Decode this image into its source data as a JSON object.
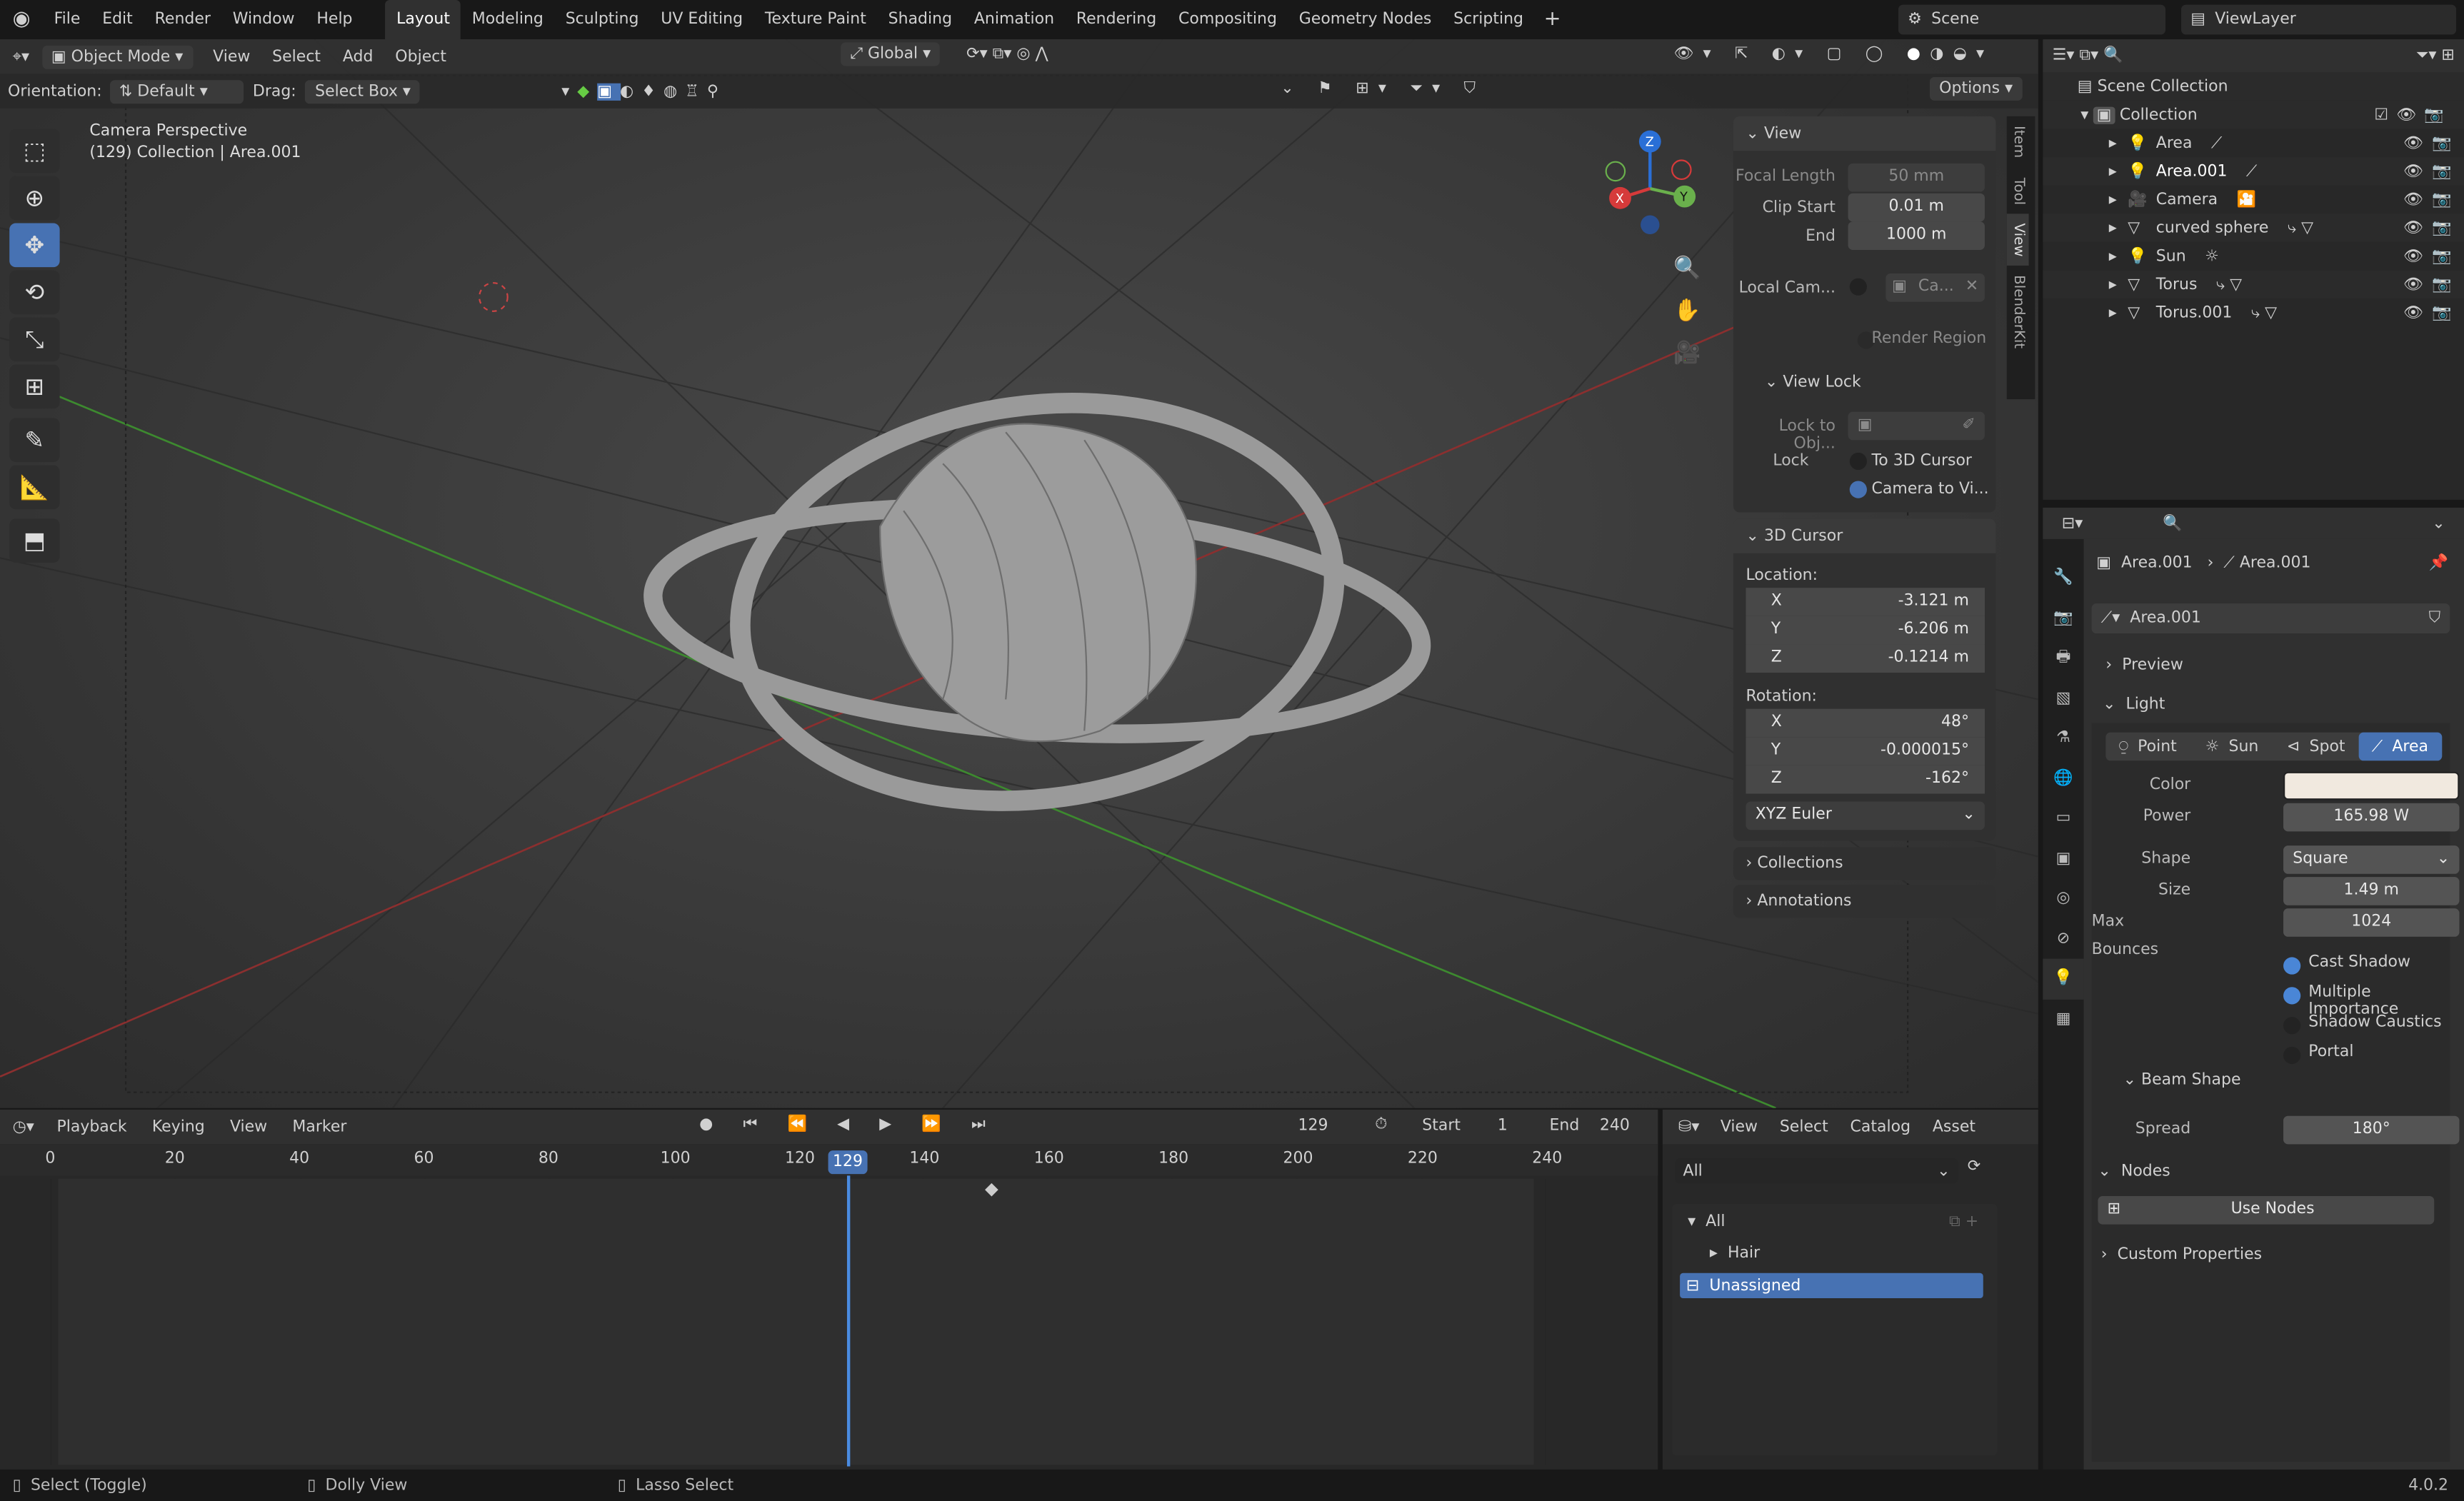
{
  "topbar": {
    "menus": [
      "File",
      "Edit",
      "Render",
      "Window",
      "Help"
    ],
    "workspaces": [
      "Layout",
      "Modeling",
      "Sculpting",
      "UV Editing",
      "Texture Paint",
      "Shading",
      "Animation",
      "Rendering",
      "Compositing",
      "Geometry Nodes",
      "Scripting"
    ],
    "active_workspace": "Layout",
    "scene": "Scene",
    "view_layer": "ViewLayer"
  },
  "viewport": {
    "mode": "Object Mode",
    "menus": [
      "View",
      "Select",
      "Add",
      "Object"
    ],
    "transform_orientation": "Global",
    "orientation_label": "Orientation:",
    "orientation_value": "Default",
    "drag_label": "Drag:",
    "drag_value": "Select Box",
    "options": "Options",
    "overlay_title": "Camera Perspective",
    "overlay_sub": "(129) Collection | Area.001",
    "gizmo": {
      "x": "X",
      "y": "Y",
      "z": "Z"
    },
    "accent": "#4772b3"
  },
  "npanel": {
    "tabs": [
      "Item",
      "Tool",
      "View",
      "BlenderKit"
    ],
    "active_tab": "View",
    "view": {
      "title": "View",
      "focal_label": "Focal Length",
      "focal": "50 mm",
      "clip_start_label": "Clip Start",
      "clip_start": "0.01 m",
      "end_label": "End",
      "end": "1000 m",
      "local_cam_label": "Local Cam...",
      "local_cam_value": "Ca...",
      "render_region": "Render Region"
    },
    "view_lock": {
      "title": "View Lock",
      "lock_obj_label": "Lock to Obj...",
      "lock_label": "Lock",
      "to_cursor": "To 3D Cursor",
      "camera_to_view": "Camera to Vi..."
    },
    "cursor": {
      "title": "3D Cursor",
      "location_label": "Location:",
      "loc": [
        {
          "axis": "X",
          "value": "-3.121 m"
        },
        {
          "axis": "Y",
          "value": "-6.206 m"
        },
        {
          "axis": "Z",
          "value": "-0.1214 m"
        }
      ],
      "rotation_label": "Rotation:",
      "rot": [
        {
          "axis": "X",
          "value": "48°"
        },
        {
          "axis": "Y",
          "value": "-0.000015°"
        },
        {
          "axis": "Z",
          "value": "-162°"
        }
      ],
      "mode": "XYZ Euler"
    },
    "collections": "Collections",
    "annotations": "Annotations"
  },
  "outliner": {
    "root": "Scene Collection",
    "collection": "Collection",
    "items": [
      {
        "name": "Area",
        "icon": "light-icon",
        "extra": "area-light-data-icon"
      },
      {
        "name": "Area.001",
        "icon": "light-icon",
        "extra": "area-light-data-icon"
      },
      {
        "name": "Camera",
        "icon": "camera-icon",
        "extra": "camera-data-icon"
      },
      {
        "name": "curved sphere",
        "icon": "mesh-icon",
        "extra": "modifier-mesh-icon"
      },
      {
        "name": "Sun",
        "icon": "light-icon",
        "extra": "sun-icon"
      },
      {
        "name": "Torus",
        "icon": "mesh-icon",
        "extra": "modifier-mesh-icon"
      },
      {
        "name": "Torus.001",
        "icon": "mesh-icon",
        "extra": "modifier-mesh-icon"
      }
    ]
  },
  "properties": {
    "breadcrumb_obj": "Area.001",
    "breadcrumb_data": "Area.001",
    "datablock": "Area.001",
    "preview": "Preview",
    "light": "Light",
    "light_types": [
      "Point",
      "Sun",
      "Spot",
      "Area"
    ],
    "active_type": "Area",
    "color_label": "Color",
    "color_value": "#f1e9df",
    "power_label": "Power",
    "power": "165.98 W",
    "shape_label": "Shape",
    "shape": "Square",
    "size_label": "Size",
    "size": "1.49 m",
    "bounces_label": "Max Bounces",
    "bounces": "1024",
    "toggles": [
      {
        "label": "Cast Shadow",
        "on": true
      },
      {
        "label": "Multiple Importance",
        "on": true
      },
      {
        "label": "Shadow Caustics",
        "on": false
      },
      {
        "label": "Portal",
        "on": false
      }
    ],
    "beam_shape": "Beam Shape",
    "spread_label": "Spread",
    "spread": "180°",
    "nodes": "Nodes",
    "use_nodes": "Use Nodes",
    "custom_props": "Custom Properties"
  },
  "timeline": {
    "menus": [
      "Playback",
      "Keying",
      "View",
      "Marker"
    ],
    "current_frame": "129",
    "start_label": "Start",
    "start": "1",
    "end_label": "End",
    "end": "240",
    "ticks": [
      "0",
      "20",
      "40",
      "60",
      "80",
      "100",
      "120",
      "140",
      "160",
      "180",
      "200",
      "220",
      "240"
    ]
  },
  "asset_browser": {
    "menus": [
      "View",
      "Select",
      "Catalog",
      "Asset"
    ],
    "filter": "All",
    "tree": [
      "All",
      "Hair",
      "Unassigned"
    ]
  },
  "status": {
    "items": [
      "Select (Toggle)",
      "Dolly View",
      "Lasso Select"
    ],
    "version": "4.0.2"
  }
}
